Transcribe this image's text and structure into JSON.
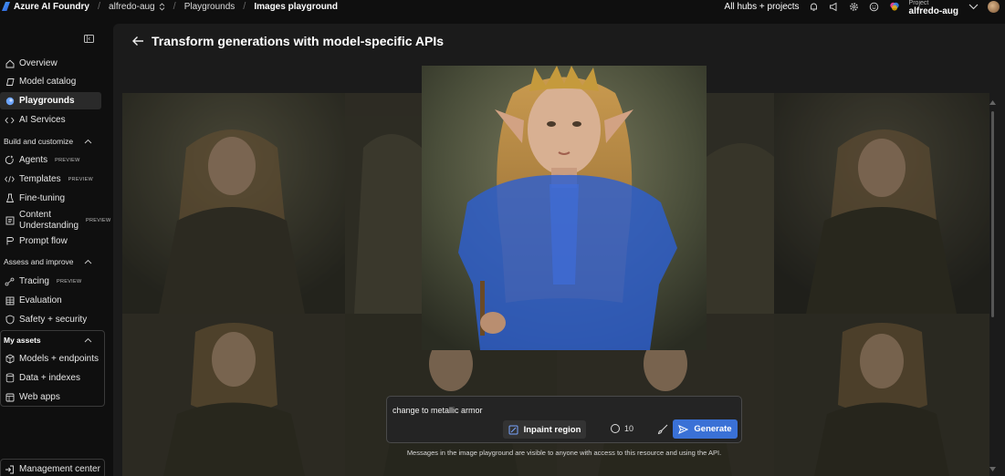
{
  "topbar": {
    "brand": "Azure AI Foundry",
    "crumb_hub": "alfredo-aug",
    "crumb_section": "Playgrounds",
    "crumb_page": "Images playground",
    "hubs_link": "All hubs + projects",
    "project_label": "Project",
    "project_name": "alfredo-aug"
  },
  "sidebar": {
    "overview": "Overview",
    "model_catalog": "Model catalog",
    "playgrounds": "Playgrounds",
    "ai_services": "AI Services",
    "build_section": "Build and customize",
    "agents": "Agents",
    "templates": "Templates",
    "fine_tuning": "Fine-tuning",
    "content_understanding_1": "Content",
    "content_understanding_2": "Understanding",
    "prompt_flow": "Prompt flow",
    "assess_section": "Assess and improve",
    "tracing": "Tracing",
    "evaluation": "Evaluation",
    "safety": "Safety + security",
    "assets_section": "My assets",
    "models_endpoints": "Models + endpoints",
    "data_indexes": "Data + indexes",
    "web_apps": "Web apps",
    "management_center": "Management center",
    "preview_badge": "PREVIEW"
  },
  "main": {
    "title": "Transform generations with model-specific APIs",
    "prompt_value": "change to metallic armor",
    "inpaint_label": "Inpaint region",
    "count_value": "10",
    "generate_label": "Generate",
    "disclaimer": "Messages in the image playground are visible to anyone with access to this resource and using the API."
  },
  "colors": {
    "accent": "#3a71d6",
    "background": "#0f0f0f",
    "panel": "#1b1b1b"
  },
  "icons": [
    "bell-icon",
    "megaphone-icon",
    "gear-icon",
    "smiley-icon",
    "copilot-icon",
    "chevron-down-icon",
    "back-arrow-icon",
    "inpaint-icon",
    "brush-icon",
    "send-icon"
  ]
}
